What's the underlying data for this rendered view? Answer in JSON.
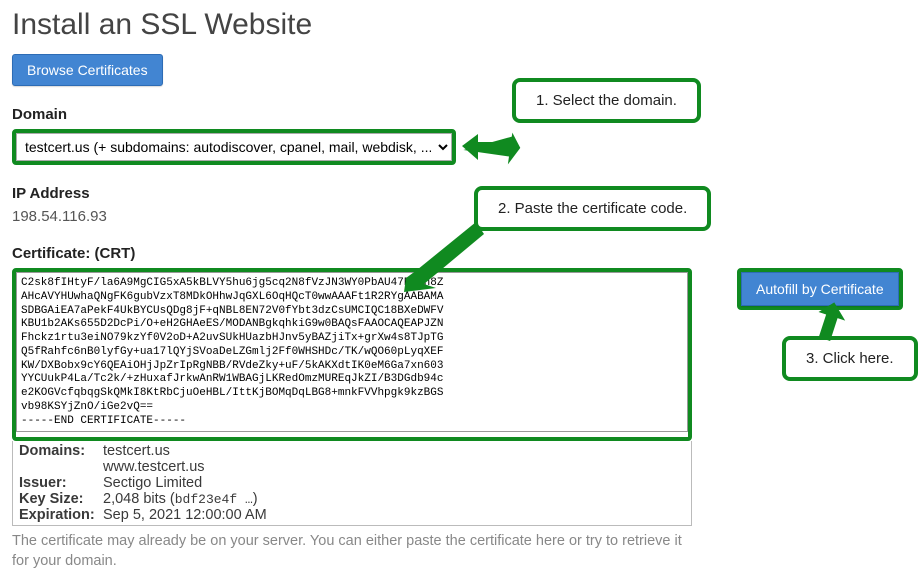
{
  "page": {
    "title": "Install an SSL Website"
  },
  "buttons": {
    "browse": "Browse Certificates",
    "autofill": "Autofill by Certificate"
  },
  "labels": {
    "domain": "Domain",
    "ip": "IP Address",
    "certificate": "Certificate: (CRT)"
  },
  "domain": {
    "selected": "testcert.us   (+ subdomains: autodiscover, cpanel, mail, webdisk, ..."
  },
  "ip": {
    "value": "198.54.116.93"
  },
  "certificate": {
    "text": "C2sk8fIHtyF/la6A9MgCIG5xA5kBLVY5hu6jg5cq2N8fVzJN3WY0PbAU47BRxh8Z\nAHcAVYHUwhaQNgFK6gubVzxT8MDkOHhwJqGXL6OqHQcT0wwAAAFt1R2RYgAABAMA\nSDBGAiEA7aPekF4UkBYCUsQDg8jF+qNBL8EN72V0fYbt3dzCsUMCIQC18BXeDWFV\nKBU1b2AKs655D2DcPi/O+eH2GHAeES/MODANBgkqhkiG9w0BAQsFAAOCAQEAPJZN\nFhckz1rtu3eiNO79kzYf0V2oD+A2uvSUkHUazbHJnv5yBAZjiTx+grXw4s8TJpTG\nQ5fRahfc6nB0lyfGy+ua17lQYjSVoaDeLZGmlj2Ff0WHSHDc/TK/wQO60pLyqXEF\nKW/DXBobx9cY6QEAiOHjJpZrIpRgNBB/RVdeZky+uF/5kAKXdtIK0eM6Ga7xn603\nYYCUukP4La/Tc2k/+zHuxafJrkwAnRW1WBAGjLKRedOmzMUREqJkZI/B3DGdb94c\ne2KOGVcfqbqgSkQMkI8KtRbCjuOeHBL/IttKjBOMqDqLBG8+mnkFVVhpgk9kzBGS\nvb98KSYjZnO/iGe2vQ==\n-----END CERTIFICATE-----"
  },
  "details": {
    "domains_label": "Domains:",
    "domains_value_1": "testcert.us",
    "domains_value_2": "www.testcert.us",
    "issuer_label": "Issuer:",
    "issuer_value": "Sectigo Limited",
    "keysize_label": "Key Size:",
    "keysize_value_prefix": "2,048 bits (",
    "keysize_value_hash": "bdf23e4f …",
    "keysize_value_suffix": ")",
    "expiration_label": "Expiration:",
    "expiration_value": "Sep 5, 2021 12:00:00 AM"
  },
  "hint": "The certificate may already be on your server. You can either paste the certificate here or try to retrieve it for your domain.",
  "callouts": {
    "one": "1. Select the domain.",
    "two": "2. Paste the certificate code.",
    "three": "3. Click here."
  }
}
